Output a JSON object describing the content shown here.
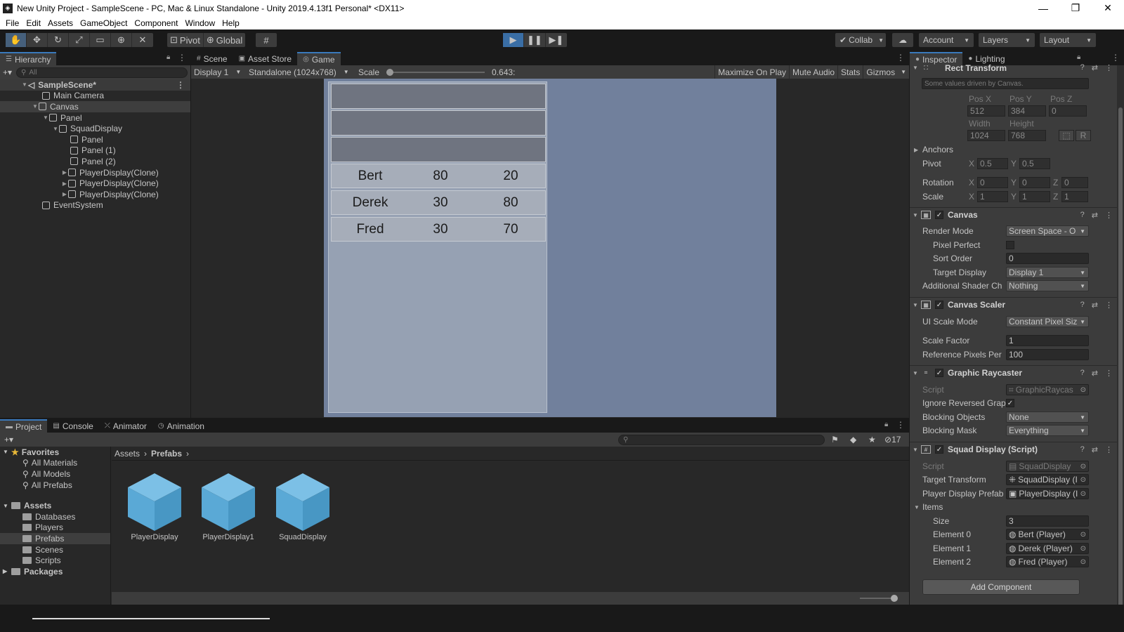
{
  "window": {
    "title": "New Unity Project - SampleScene - PC, Mac & Linux Standalone - Unity 2019.4.13f1 Personal* <DX11>",
    "minimize": "—",
    "maximize": "❐",
    "close": "✕"
  },
  "menu": [
    "File",
    "Edit",
    "Assets",
    "GameObject",
    "Component",
    "Window",
    "Help"
  ],
  "toolbar": {
    "pivot": "Pivot",
    "global": "Global",
    "collab": "Collab",
    "account": "Account",
    "layers": "Layers",
    "layout": "Layout"
  },
  "hierarchy": {
    "tab": "Hierarchy",
    "search_placeholder": "All",
    "items": [
      {
        "label": "SampleScene*",
        "depth": 0
      },
      {
        "label": "Main Camera",
        "depth": 1
      },
      {
        "label": "Canvas",
        "depth": 1
      },
      {
        "label": "Panel",
        "depth": 2
      },
      {
        "label": "SquadDisplay",
        "depth": 3
      },
      {
        "label": "Panel",
        "depth": 4
      },
      {
        "label": "Panel (1)",
        "depth": 4
      },
      {
        "label": "Panel (2)",
        "depth": 4
      },
      {
        "label": "PlayerDisplay(Clone)",
        "depth": 4
      },
      {
        "label": "PlayerDisplay(Clone)",
        "depth": 4
      },
      {
        "label": "PlayerDisplay(Clone)",
        "depth": 4
      },
      {
        "label": "EventSystem",
        "depth": 1
      }
    ]
  },
  "center_tabs": [
    "Scene",
    "Asset Store",
    "Game"
  ],
  "gamebar": {
    "display": "Display 1",
    "resolution": "Standalone (1024x768)",
    "scale_label": "Scale",
    "scale_value": "0.643:",
    "maximize": "Maximize On Play",
    "mute": "Mute Audio",
    "stats": "Stats",
    "gizmos": "Gizmos"
  },
  "game": {
    "players": [
      {
        "name": "Bert",
        "a": "80",
        "b": "20"
      },
      {
        "name": "Derek",
        "a": "30",
        "b": "80"
      },
      {
        "name": "Fred",
        "a": "30",
        "b": "70"
      }
    ]
  },
  "inspector": {
    "tab": "Inspector",
    "tab2": "Lighting",
    "rect": {
      "title": "Rect Transform",
      "note": "Some values driven by Canvas.",
      "posx_l": "Pos X",
      "posy_l": "Pos Y",
      "posz_l": "Pos Z",
      "posx": "512",
      "posy": "384",
      "posz": "0",
      "width_l": "Width",
      "height_l": "Height",
      "width": "1024",
      "height": "768",
      "anchors": "Anchors",
      "pivot": "Pivot",
      "pivot_x": "0.5",
      "pivot_y": "0.5",
      "rotation": "Rotation",
      "rot_x": "0",
      "rot_y": "0",
      "rot_z": "0",
      "scale": "Scale",
      "sc_x": "1",
      "sc_y": "1",
      "sc_z": "1"
    },
    "canvas": {
      "title": "Canvas",
      "render_mode_l": "Render Mode",
      "render_mode": "Screen Space - O",
      "pixel_perfect_l": "Pixel Perfect",
      "sort_order_l": "Sort Order",
      "sort_order": "0",
      "target_display_l": "Target Display",
      "target_display": "Display 1",
      "shader_l": "Additional Shader Ch",
      "shader": "Nothing"
    },
    "scaler": {
      "title": "Canvas Scaler",
      "mode_l": "UI Scale Mode",
      "mode": "Constant Pixel Siz",
      "factor_l": "Scale Factor",
      "factor": "1",
      "ref_l": "Reference Pixels Per",
      "ref": "100"
    },
    "raycaster": {
      "title": "Graphic Raycaster",
      "script_l": "Script",
      "script": "GraphicRaycas",
      "ignore_l": "Ignore Reversed Grap",
      "blocking_l": "Blocking Objects",
      "blocking": "None",
      "mask_l": "Blocking Mask",
      "mask": "Everything"
    },
    "squad": {
      "title": "Squad Display (Script)",
      "script_l": "Script",
      "script": "SquadDisplay",
      "target_l": "Target Transform",
      "target": "SquadDisplay (I",
      "prefab_l": "Player Display Prefab",
      "prefab": "PlayerDisplay (I",
      "items_l": "Items",
      "size_l": "Size",
      "size": "3",
      "e0_l": "Element 0",
      "e0": "Bert (Player)",
      "e1_l": "Element 1",
      "e1": "Derek (Player)",
      "e2_l": "Element 2",
      "e2": "Fred (Player)"
    },
    "add_component": "Add Component"
  },
  "project": {
    "tabs": [
      "Project",
      "Console",
      "Animator",
      "Animation"
    ],
    "hidden_count": "17",
    "tree": [
      {
        "label": "Favorites",
        "kind": "fav"
      },
      {
        "label": "All Materials",
        "kind": "search"
      },
      {
        "label": "All Models",
        "kind": "search"
      },
      {
        "label": "All Prefabs",
        "kind": "search"
      },
      {
        "label": "Assets",
        "kind": "root"
      },
      {
        "label": "Databases",
        "kind": "folder"
      },
      {
        "label": "Players",
        "kind": "folder"
      },
      {
        "label": "Prefabs",
        "kind": "folder"
      },
      {
        "label": "Scenes",
        "kind": "folder"
      },
      {
        "label": "Scripts",
        "kind": "folder"
      },
      {
        "label": "Packages",
        "kind": "root"
      }
    ],
    "breadcrumb": [
      "Assets",
      "Prefabs"
    ],
    "assets": [
      "PlayerDisplay",
      "PlayerDisplay1",
      "SquadDisplay"
    ]
  },
  "colors": {
    "accent": "#3a79bb",
    "prefab_cube": "#5aa9d6",
    "game_bg": "#71809c"
  }
}
